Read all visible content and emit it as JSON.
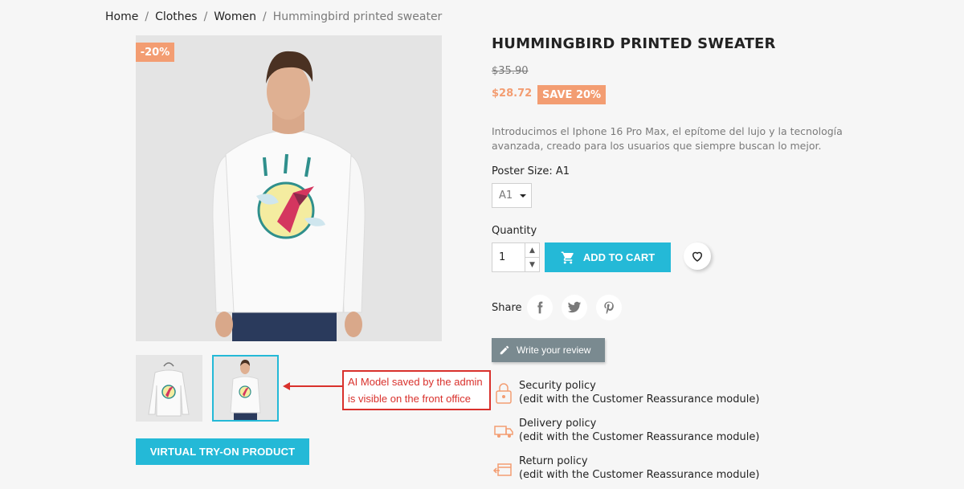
{
  "breadcrumb": {
    "home": "Home",
    "category": "Clothes",
    "subcategory": "Women",
    "current": "Hummingbird printed sweater"
  },
  "product": {
    "discount_flag": "-20%",
    "title": "HUMMINGBIRD PRINTED SWEATER",
    "regular_price": "$35.90",
    "current_price": "$28.72",
    "save_badge": "SAVE 20%",
    "description": "Introducimos el Iphone 16 Pro Max, el epítome del lujo y la tecnología avanzada, creado para los usuarios que siempre buscan lo mejor.",
    "variant_label": "Poster Size: A1",
    "variant_value": "A1",
    "quantity_label": "Quantity",
    "quantity_value": "1",
    "add_to_cart": "ADD TO CART"
  },
  "gallery": {
    "vto_button": "VIRTUAL TRY-ON PRODUCT"
  },
  "annotation": {
    "line1": "AI Model saved by the admin",
    "line2": "is visible on the front office",
    "color": "#d9312c"
  },
  "share": {
    "label": "Share",
    "icons": [
      "facebook-icon",
      "twitter-icon",
      "pinterest-icon"
    ]
  },
  "review": {
    "label": "Write your review"
  },
  "reassurance": [
    {
      "title": "Security policy",
      "subtitle": "(edit with the Customer Reassurance module)",
      "icon": "lock-icon"
    },
    {
      "title": "Delivery policy",
      "subtitle": "(edit with the Customer Reassurance module)",
      "icon": "truck-icon"
    },
    {
      "title": "Return policy",
      "subtitle": "(edit with the Customer Reassurance module)",
      "icon": "return-box-icon"
    }
  ],
  "colors": {
    "accent": "#24b9d7",
    "discount": "#f39d72",
    "review_button": "#7a8a90",
    "background": "#f6f6f6"
  }
}
